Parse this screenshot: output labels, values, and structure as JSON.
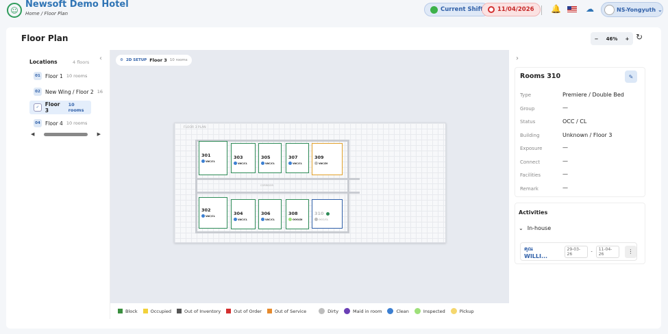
{
  "header": {
    "brand": "Newsoft Demo Hotel",
    "breadcrumb": "Home  /  Floor Plan",
    "shift_label": "Current Shift",
    "date_label": "11/04/2026",
    "user_label": "NS-Yongyuth"
  },
  "page": {
    "title": "Floor Plan",
    "zoom": "46%"
  },
  "locations": {
    "title": "Locations",
    "count": "4 floors",
    "floors": [
      {
        "num": "01",
        "name": "Floor 1",
        "rooms": "10 rooms"
      },
      {
        "num": "02",
        "name": "New Wing / Floor 2",
        "rooms": "16"
      },
      {
        "num": "03",
        "name": "Floor 3",
        "rooms": "10 rooms"
      },
      {
        "num": "04",
        "name": "Floor 4",
        "rooms": "10 rooms"
      }
    ]
  },
  "canvas": {
    "setup_tag": "2D SETUP",
    "floor": "Floor 3",
    "rooms": "10 rooms",
    "plan_label": "FLOOR 3 PLAN",
    "rooms_list": [
      {
        "num": "301",
        "status": "VAC/CL"
      },
      {
        "num": "303",
        "status": "VAC/CL"
      },
      {
        "num": "305",
        "status": "VAC/CL"
      },
      {
        "num": "307",
        "status": "VAC/CL"
      },
      {
        "num": "309",
        "status": "VAC/DI"
      },
      {
        "num": "302",
        "status": "VAC/CL"
      },
      {
        "num": "304",
        "status": "VAC/CL"
      },
      {
        "num": "306",
        "status": "VAC/CL"
      },
      {
        "num": "308",
        "status": "OOO/DI"
      },
      {
        "num": "310",
        "status": "OCC/CL"
      }
    ]
  },
  "legend": [
    {
      "label": "Block",
      "color": "#3a8f3f"
    },
    {
      "label": "Occupied",
      "color": "#f2d13b"
    },
    {
      "label": "Out of Inventory",
      "color": "#555555"
    },
    {
      "label": "Out of Order",
      "color": "#d32f2f"
    },
    {
      "label": "Out of Service",
      "color": "#e58a2e"
    },
    {
      "label": "Dirty",
      "color": "#bdbdbd"
    },
    {
      "label": "Maid in room",
      "color": "#6a3fb5"
    },
    {
      "label": "Clean",
      "color": "#3c7fd1"
    },
    {
      "label": "Inspected",
      "color": "#9ee07a"
    },
    {
      "label": "Pickup",
      "color": "#f5d76e"
    }
  ],
  "room_detail": {
    "title": "Rooms 310",
    "fields": [
      {
        "k": "Type",
        "v": "Premiere / Double Bed"
      },
      {
        "k": "Group",
        "v": "—"
      },
      {
        "k": "Status",
        "v": "OCC / CL"
      },
      {
        "k": "Building",
        "v": "Unknown / Floor 3"
      },
      {
        "k": "Exposure",
        "v": "—"
      },
      {
        "k": "Connect",
        "v": "—"
      },
      {
        "k": "Facilities",
        "v": "—"
      },
      {
        "k": "Remark",
        "v": "—"
      }
    ]
  },
  "activities": {
    "title": "Activities",
    "section": "In-house",
    "guest": "คุณ WILLI...",
    "from": "29-03-26",
    "to": "11-04-26"
  }
}
